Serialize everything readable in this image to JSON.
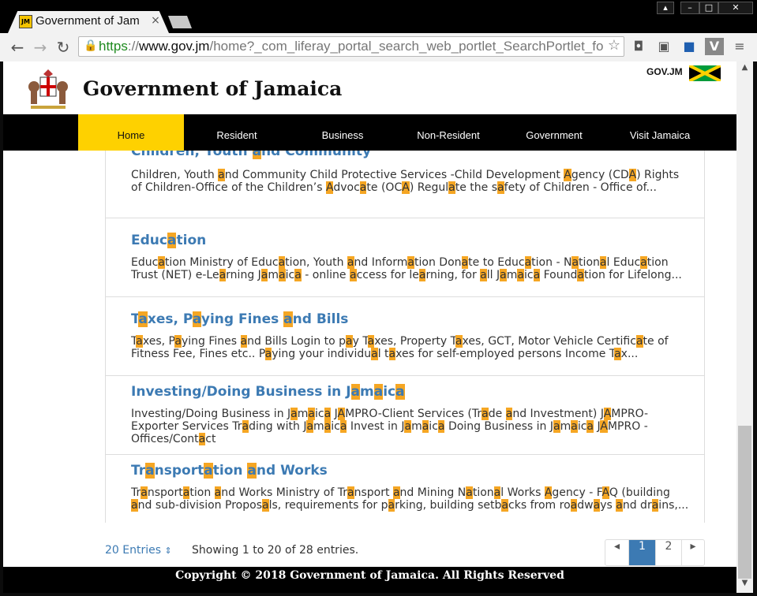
{
  "browser": {
    "tab_title": "Government of Jam",
    "tab_favicon_text": "JM",
    "url_scheme": "https",
    "url_host": "www.gov.jm",
    "url_path": "/home?_com_liferay_portal_search_web_portlet_SearchPortlet_formDat"
  },
  "site": {
    "title": "Government of Jamaica",
    "gov_badge": "GOV.JM",
    "nav": [
      "Home",
      "Resident",
      "Business",
      "Non-Resident",
      "Government",
      "Visit Jamaica"
    ],
    "active_nav": "Home",
    "colors": {
      "nav_active": "#fed100",
      "link": "#3c7ab3",
      "highlight": "#f5a623"
    }
  },
  "results": [
    {
      "title": "Children, Youth and Community",
      "body": "Children, Youth and Community Child Protective Services -Child Development Agency (CDA) Rights of Children-Office of the Children’s Advocate (OCA) Regulate the safety of Children - Office of..."
    },
    {
      "title": "Education",
      "body": "Education Ministry of Education, Youth and Information Donate to Education - National Education Trust (NET) e-Learning Jamaica - online access for learning, for all Jamaica Foundation for Lifelong..."
    },
    {
      "title": "Taxes, Paying Fines and Bills",
      "body": "Taxes, Paying Fines and Bills Login to pay Taxes, Property Taxes, GCT, Motor Vehicle Certificate of Fitness Fee, Fines etc.. Paying your individual taxes for self-employed persons Income Tax..."
    },
    {
      "title": "Investing/Doing Business in Jamaica",
      "body": "Investing/Doing Business in Jamaica JAMPRO-Client Services (Trade and Investment) JAMPRO-Exporter Services Trading with Jamaica Invest in Jamaica Doing Business in Jamaica JAMPRO - Offices/Contact"
    },
    {
      "title": "Transportation and Works",
      "body": "Transportation and Works Ministry of Transport and Mining National Works Agency - FAQ (building and sub-division Proposals, requirements for parking, building setbacks from roadways and drains,..."
    }
  ],
  "footer": {
    "entries_label": "20 Entries",
    "showing": "Showing 1 to 20 of 28 entries.",
    "pages": [
      "1",
      "2"
    ],
    "current_page": "1",
    "copyright": "Copyright © 2018 Government of Jamaica. All Rights Reserved"
  }
}
